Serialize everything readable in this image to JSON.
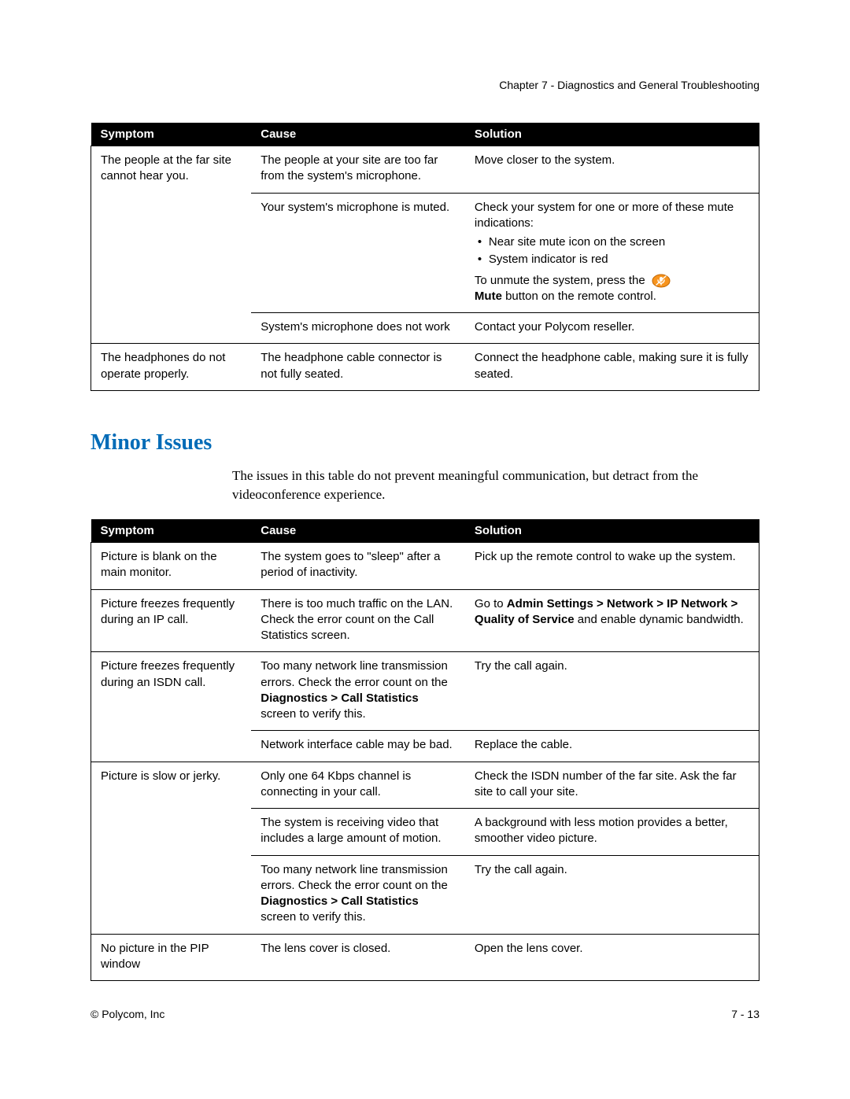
{
  "header": {
    "chapter": "Chapter 7 - Diagnostics and General Troubleshooting"
  },
  "table1": {
    "headers": {
      "symptom": "Symptom",
      "cause": "Cause",
      "solution": "Solution"
    },
    "rows": [
      {
        "symptom": "The people at the far site cannot hear you.",
        "cause": "The people at your site are too far from the system's microphone.",
        "solution": "Move closer to the system."
      },
      {
        "symptom": "",
        "cause": "Your system's microphone is muted.",
        "solution": {
          "intro": "Check your system for one or more of these mute indications:",
          "bullets": [
            "Near site mute icon on the screen",
            "System indicator is red"
          ],
          "outro_pre": "To unmute the system, press the ",
          "outro_bold": "Mute",
          "outro_post": " button on the remote  control."
        }
      },
      {
        "symptom": "",
        "cause": "System's microphone does not work",
        "solution": "Contact your Polycom reseller."
      },
      {
        "symptom": "The headphones do not operate properly.",
        "cause": "The headphone cable connector is not fully seated.",
        "solution": "Connect the headphone cable, making sure it is fully seated."
      }
    ]
  },
  "section2": {
    "title": "Minor Issues",
    "intro": "The issues in this table do not prevent meaningful communication, but detract from the videoconference experience."
  },
  "table2": {
    "headers": {
      "symptom": "Symptom",
      "cause": "Cause",
      "solution": "Solution"
    },
    "rows": [
      {
        "symptom": "Picture is blank on the main monitor.",
        "cause": "The system goes to \"sleep\" after a period of inactivity.",
        "solution": "Pick up the remote control to wake up the system."
      },
      {
        "symptom": "Picture freezes frequently during an IP call.",
        "cause": "There is too much traffic on the LAN. Check the error count on the Call Statistics screen.",
        "solution_pre": "Go to ",
        "solution_bold": "Admin Settings > Network > IP Network > Quality of Service",
        "solution_post": " and enable dynamic bandwidth."
      },
      {
        "symptom": "Picture freezes frequently during an ISDN call.",
        "cause_pre": "Too many network line transmission errors. Check the error count on the ",
        "cause_bold": "Diagnostics > Call Statistics",
        "cause_post": " screen to verify this.",
        "solution": "Try the call again."
      },
      {
        "symptom": "",
        "cause": "Network interface cable may be bad.",
        "solution": "Replace the cable."
      },
      {
        "symptom": "Picture is slow or jerky.",
        "cause": "Only one 64 Kbps channel is connecting in your call.",
        "solution": "Check the ISDN number of the far site. Ask the far site to call your site."
      },
      {
        "symptom": "",
        "cause": "The system is receiving video that includes a large amount of motion.",
        "solution": "A background with less motion provides a better, smoother video picture."
      },
      {
        "symptom": "",
        "cause_pre": "Too many network line transmission errors. Check the error count on the ",
        "cause_bold": "Diagnostics > Call Statistics",
        "cause_post": " screen to verify this.",
        "solution": "Try the call again."
      },
      {
        "symptom": "No picture in the PIP window",
        "cause": "The lens cover is closed.",
        "solution": "Open the lens cover."
      }
    ]
  },
  "footer": {
    "left": "© Polycom, Inc",
    "right": "7 - 13"
  }
}
